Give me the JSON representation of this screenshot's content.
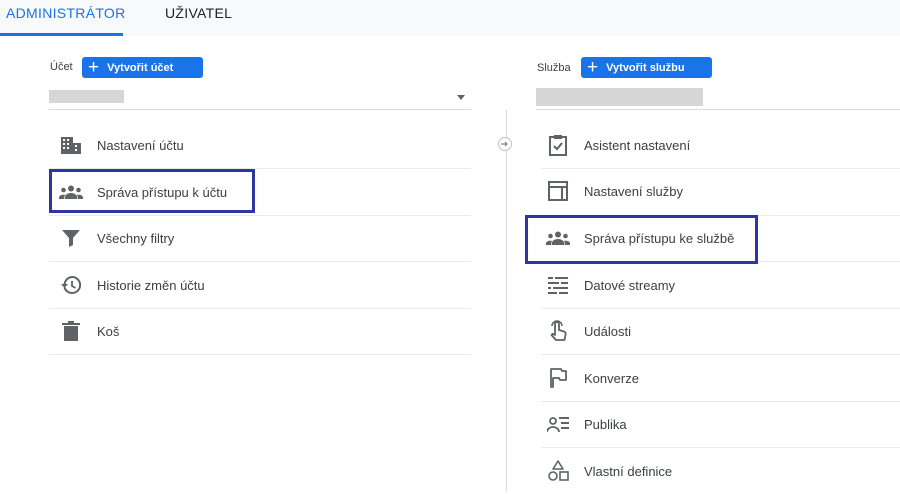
{
  "tabs": {
    "admin": "ADMINISTRÁTOR",
    "user": "UŽIVATEL"
  },
  "account": {
    "label": "Účet",
    "create_button": "Vytvořit účet",
    "items": [
      {
        "label": "Nastavení účtu",
        "icon": "building-icon"
      },
      {
        "label": "Správa přístupu k účtu",
        "icon": "people-icon"
      },
      {
        "label": "Všechny filtry",
        "icon": "filter-icon"
      },
      {
        "label": "Historie změn účtu",
        "icon": "history-icon"
      },
      {
        "label": "Koš",
        "icon": "trash-icon"
      }
    ]
  },
  "property": {
    "label": "Služba",
    "create_button": "Vytvořit službu",
    "items": [
      {
        "label": "Asistent nastavení",
        "icon": "checklist-icon"
      },
      {
        "label": "Nastavení služby",
        "icon": "layout-icon"
      },
      {
        "label": "Správa přístupu ke službě",
        "icon": "people-icon"
      },
      {
        "label": "Datové streamy",
        "icon": "streams-icon"
      },
      {
        "label": "Události",
        "icon": "touch-icon"
      },
      {
        "label": "Konverze",
        "icon": "flag-icon"
      },
      {
        "label": "Publika",
        "icon": "audience-icon"
      },
      {
        "label": "Vlastní definice",
        "icon": "shapes-icon"
      }
    ]
  },
  "colors": {
    "accent": "#1a73e8",
    "highlight": "#2e36a0",
    "icon": "#5f6368"
  }
}
